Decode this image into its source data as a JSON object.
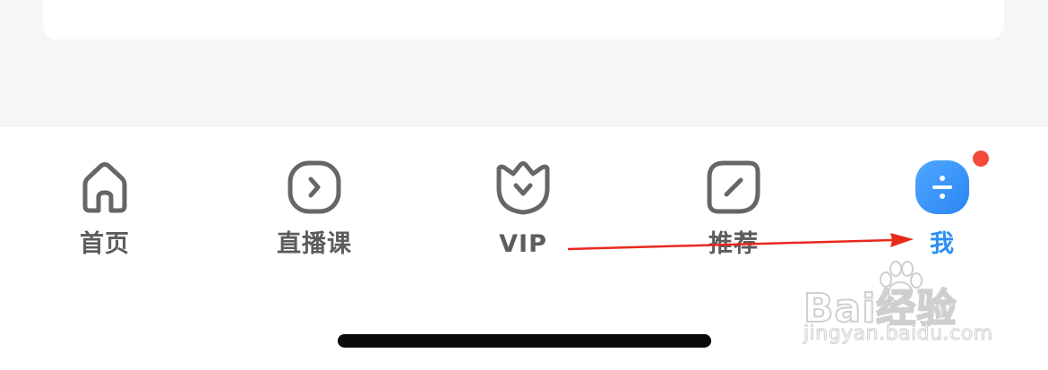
{
  "tabbar": {
    "items": [
      {
        "label": "首页",
        "icon": "home-icon",
        "active": false
      },
      {
        "label": "直播课",
        "icon": "live-class-icon",
        "active": false
      },
      {
        "label": "VIP",
        "icon": "vip-crown-icon",
        "active": false
      },
      {
        "label": "推荐",
        "icon": "recommend-icon",
        "active": false
      },
      {
        "label": "我",
        "icon": "profile-icon",
        "active": true
      }
    ]
  },
  "colors": {
    "accent": "#2c8ef6",
    "inactive_label": "#5c5c5c",
    "inactive_icon": "#666666",
    "badge": "#f24b3c",
    "annotation_arrow": "#e8291c",
    "background": "#f5f6f8"
  },
  "watermark": {
    "brand": "Bai经验",
    "url": "jingyan.baidu.com"
  }
}
